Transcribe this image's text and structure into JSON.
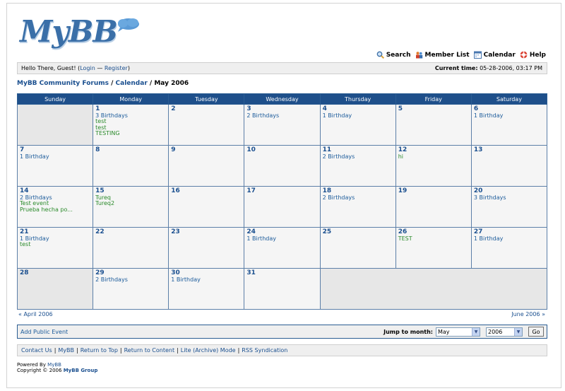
{
  "brand": {
    "logo_text": "MyBB"
  },
  "toplinks": [
    {
      "label": "Search",
      "icon": "search-icon"
    },
    {
      "label": "Member List",
      "icon": "members-icon"
    },
    {
      "label": "Calendar",
      "icon": "calendar-icon"
    },
    {
      "label": "Help",
      "icon": "help-icon"
    }
  ],
  "welcome": {
    "prefix": "Hello There, Guest! (",
    "login": "Login",
    "dash": " — ",
    "register": "Register",
    "suffix": ")",
    "time_label": "Current time:",
    "time_value": "05-28-2006, 03:17 PM"
  },
  "breadcrumb": {
    "forum": "MyBB Community Forums",
    "sep1": " / ",
    "calendar": "Calendar",
    "sep2": " / ",
    "current": "May 2006"
  },
  "calendar": {
    "days": [
      "Sunday",
      "Monday",
      "Tuesday",
      "Wednesday",
      "Thursday",
      "Friday",
      "Saturday"
    ],
    "weeks": [
      [
        {
          "num": "",
          "items": [],
          "gray": true
        },
        {
          "num": "1",
          "items": [
            {
              "t": "3 Birthdays",
              "k": "bday"
            },
            {
              "t": "test",
              "k": "evt"
            },
            {
              "t": "test",
              "k": "evt"
            },
            {
              "t": "TESTING",
              "k": "evt"
            }
          ]
        },
        {
          "num": "2",
          "items": []
        },
        {
          "num": "3",
          "items": [
            {
              "t": "2 Birthdays",
              "k": "bday"
            }
          ]
        },
        {
          "num": "4",
          "items": [
            {
              "t": "1 Birthday",
              "k": "bday"
            }
          ]
        },
        {
          "num": "5",
          "items": []
        },
        {
          "num": "6",
          "items": [
            {
              "t": "1 Birthday",
              "k": "bday"
            }
          ]
        }
      ],
      [
        {
          "num": "7",
          "items": [
            {
              "t": "1 Birthday",
              "k": "bday"
            }
          ]
        },
        {
          "num": "8",
          "items": []
        },
        {
          "num": "9",
          "items": []
        },
        {
          "num": "10",
          "items": []
        },
        {
          "num": "11",
          "items": [
            {
              "t": "2 Birthdays",
              "k": "bday"
            }
          ]
        },
        {
          "num": "12",
          "items": [
            {
              "t": "hi",
              "k": "evt"
            }
          ]
        },
        {
          "num": "13",
          "items": []
        }
      ],
      [
        {
          "num": "14",
          "items": [
            {
              "t": "2 Birthdays",
              "k": "bday"
            },
            {
              "t": "Test event",
              "k": "evt"
            },
            {
              "t": "Prueba hecha po...",
              "k": "evt"
            }
          ]
        },
        {
          "num": "15",
          "items": [
            {
              "t": "Tureq",
              "k": "evt"
            },
            {
              "t": "Tureq2",
              "k": "evt"
            }
          ]
        },
        {
          "num": "16",
          "items": []
        },
        {
          "num": "17",
          "items": []
        },
        {
          "num": "18",
          "items": [
            {
              "t": "2 Birthdays",
              "k": "bday"
            }
          ]
        },
        {
          "num": "19",
          "items": []
        },
        {
          "num": "20",
          "items": [
            {
              "t": "3 Birthdays",
              "k": "bday"
            }
          ]
        }
      ],
      [
        {
          "num": "21",
          "items": [
            {
              "t": "1 Birthday",
              "k": "bday"
            },
            {
              "t": "test",
              "k": "evt"
            }
          ]
        },
        {
          "num": "22",
          "items": []
        },
        {
          "num": "23",
          "items": []
        },
        {
          "num": "24",
          "items": [
            {
              "t": "1 Birthday",
              "k": "bday"
            }
          ]
        },
        {
          "num": "25",
          "items": []
        },
        {
          "num": "26",
          "items": [
            {
              "t": "TEST",
              "k": "evt"
            }
          ]
        },
        {
          "num": "27",
          "items": [
            {
              "t": "1 Birthday",
              "k": "bday"
            }
          ]
        }
      ],
      [
        {
          "num": "28",
          "items": [],
          "gray": true
        },
        {
          "num": "29",
          "items": [
            {
              "t": "2 Birthdays",
              "k": "bday"
            }
          ]
        },
        {
          "num": "30",
          "items": [
            {
              "t": "1 Birthday",
              "k": "bday"
            }
          ]
        },
        {
          "num": "31",
          "items": []
        }
      ]
    ]
  },
  "nav": {
    "prev": "« April 2006",
    "next": "June 2006 »"
  },
  "actions": {
    "add_event": "Add Public Event",
    "jump_label": "Jump to month:",
    "month_value": "May",
    "year_value": "2006",
    "go_label": "Go"
  },
  "footer": {
    "links": [
      "Contact Us",
      "MyBB",
      "Return to Top",
      "Return to Content",
      "Lite (Archive) Mode",
      "RSS Syndication"
    ]
  },
  "powered": {
    "prefix": "Powered By ",
    "link": "MyBB",
    "copyright": "Copyright © 2006 ",
    "group": "MyBB Group"
  },
  "colors": {
    "header_blue": "#1e4f8a",
    "link_blue": "#1a4f8f",
    "event_green": "#2a8a2a"
  }
}
